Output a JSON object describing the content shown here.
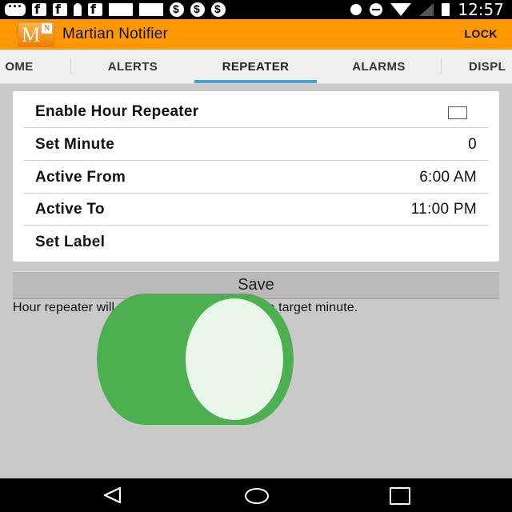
{
  "status_bar": {
    "time": "12:57",
    "icons": [
      "chat-icon",
      "facebook-icon",
      "facebook-icon",
      "person-icon",
      "facebook-icon",
      "image-icon",
      "image-icon",
      "dollar-icon",
      "dollar-icon",
      "dollar-icon",
      "location-icon",
      "do-not-disturb-icon",
      "wifi-icon",
      "signal-icon",
      "battery-icon"
    ]
  },
  "app_bar": {
    "logo_letter": "M",
    "logo_badge": "N",
    "title": "Martian Notifier",
    "lock_label": "LOCK",
    "color": "#ff9800"
  },
  "tabs": {
    "items": [
      {
        "label": "OME"
      },
      {
        "label": "ALERTS"
      },
      {
        "label": "REPEATER"
      },
      {
        "label": "ALARMS"
      },
      {
        "label": "DISPL"
      }
    ],
    "selected": "REPEATER",
    "indicator_color": "#41a5d8"
  },
  "settings": {
    "enable_label": "Enable Hour Repeater",
    "enable_checked": false,
    "set_minute_label": "Set Minute",
    "set_minute_value": "0",
    "active_from_label": "Active From",
    "active_from_value": "6:00 AM",
    "active_to_label": "Active To",
    "active_to_value": "11:00 PM",
    "set_label_label": "Set Label"
  },
  "save_label": "Save",
  "help_text": "Hour repeater will notify you every hour at the target minute.",
  "overlay": {
    "shape": "cylinder",
    "body_color": "#4caf50",
    "face_color": "#e8f5e9"
  },
  "nav_bar": {
    "icons": [
      "back-icon",
      "home-icon",
      "recents-icon"
    ]
  }
}
